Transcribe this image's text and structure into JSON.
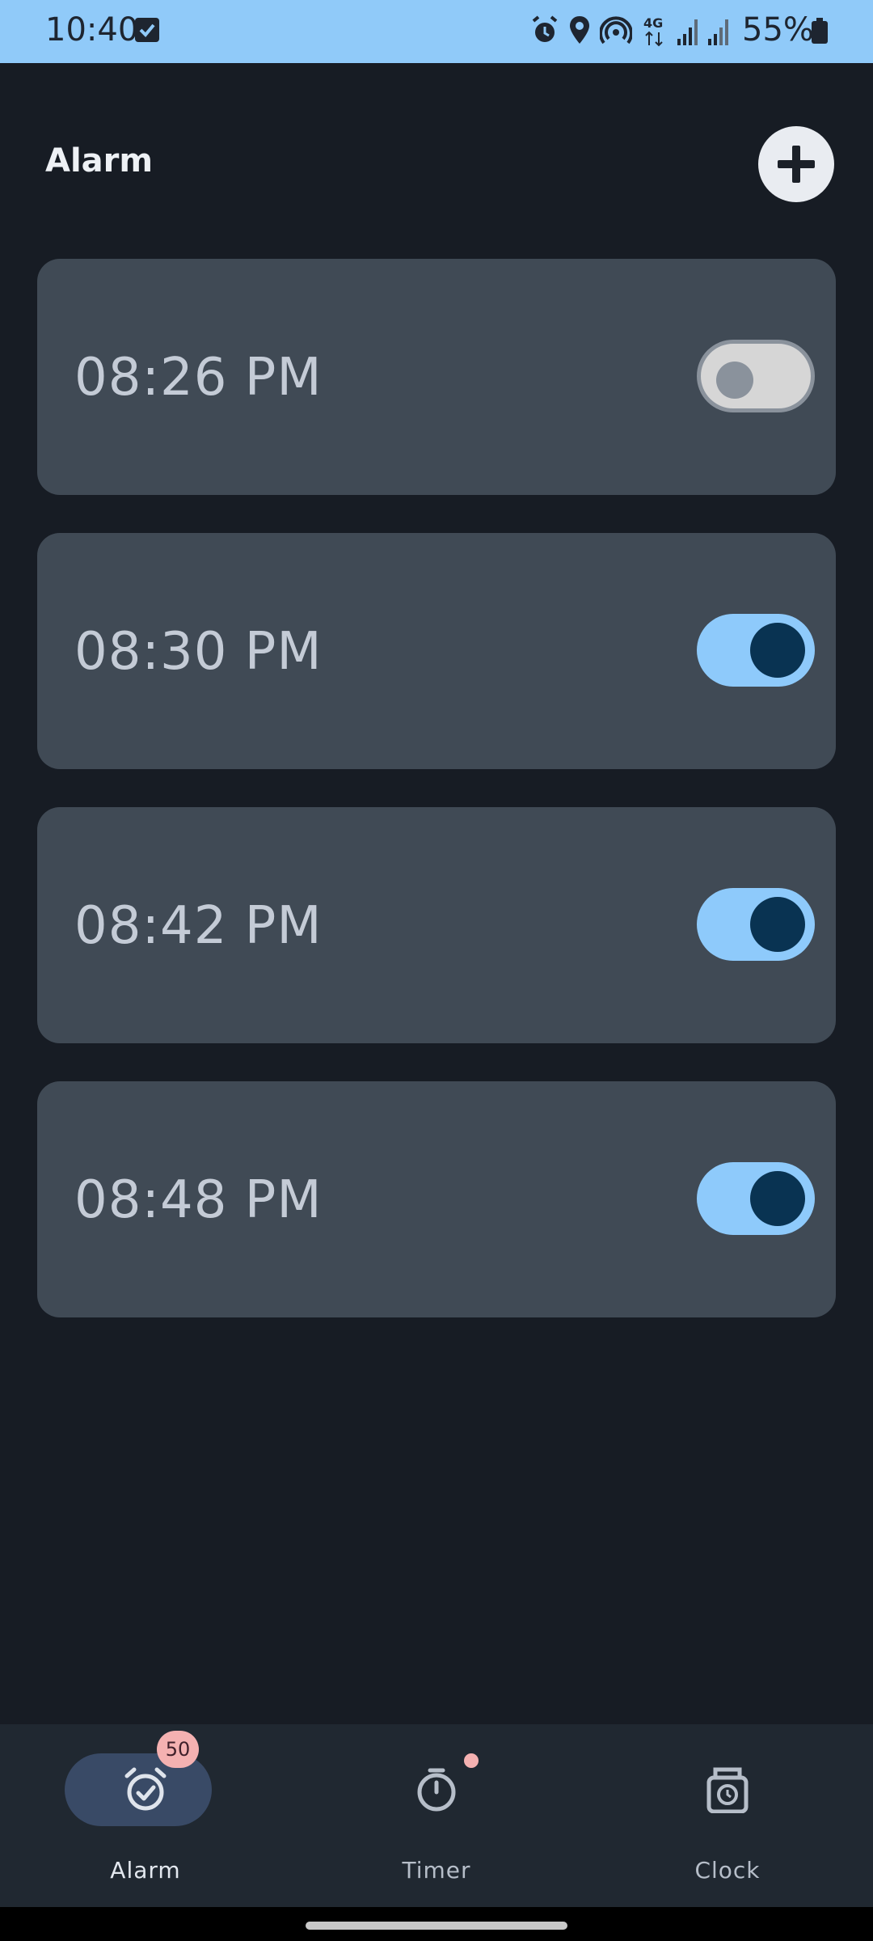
{
  "status_bar": {
    "time": "10:40",
    "battery_text": "55%",
    "icons": [
      "checkbox-icon",
      "alarm-icon",
      "location-icon",
      "hotspot-icon",
      "4g-icon",
      "signal-icon",
      "signal-icon",
      "battery-icon"
    ]
  },
  "header": {
    "title": "Alarm",
    "add_icon": "plus-icon"
  },
  "alarms": [
    {
      "time": "08:26 PM",
      "enabled": false
    },
    {
      "time": "08:30 PM",
      "enabled": true
    },
    {
      "time": "08:42 PM",
      "enabled": true
    },
    {
      "time": "08:48 PM",
      "enabled": true
    }
  ],
  "bottom_nav": {
    "items": [
      {
        "label": "Alarm",
        "icon": "alarm-check-icon",
        "active": true,
        "badge": "50"
      },
      {
        "label": "Timer",
        "icon": "stopwatch-icon",
        "active": false,
        "dot": true
      },
      {
        "label": "Clock",
        "icon": "clock-icon",
        "active": false
      }
    ]
  },
  "colors": {
    "background": "#171c24",
    "card": "#404a55",
    "accent": "#8ecafb",
    "status_bar": "#90caf9",
    "badge": "#f4b1b1"
  }
}
